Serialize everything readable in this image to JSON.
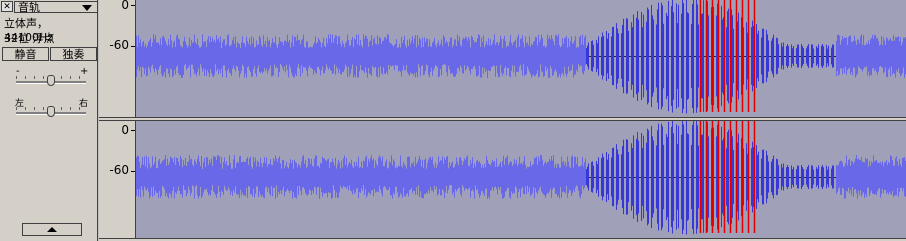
{
  "track": {
    "name": "音轨",
    "info_line1": "立体声，44100Hz",
    "info_line2": "32位 浮点",
    "mute_label": "静音",
    "solo_label": "独奏",
    "gain_minus": "-",
    "gain_plus": "+",
    "pan_left": "左",
    "pan_right": "右",
    "gain_value": 0.5,
    "pan_value": 0.5
  },
  "channels": [
    {
      "name": "left",
      "scale_labels": [
        "0",
        "-60"
      ]
    },
    {
      "name": "right",
      "scale_labels": [
        "0",
        "-60"
      ]
    }
  ],
  "colors": {
    "wave_background": "#a0a0b8",
    "waveform": "#3838d8",
    "waveform_light": "#6868e8",
    "clipping": "#e00000",
    "panel": "#d4d0c8"
  }
}
